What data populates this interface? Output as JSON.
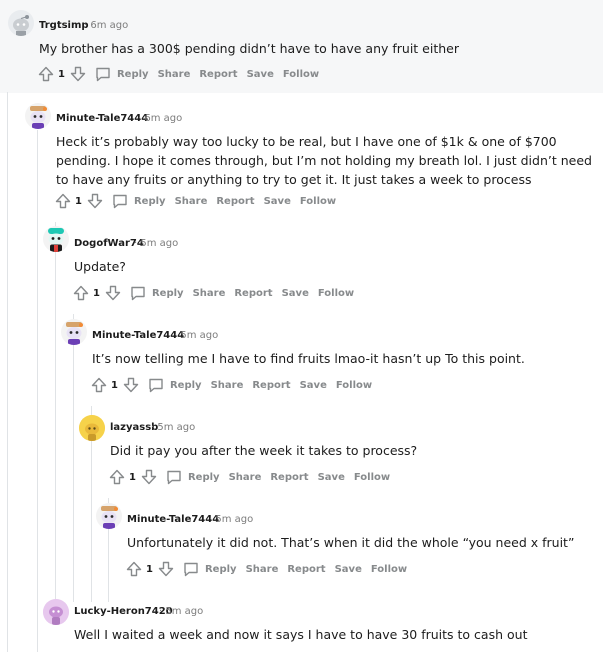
{
  "actions": {
    "reply": "Reply",
    "share": "Share",
    "report": "Report",
    "save": "Save",
    "follow": "Follow"
  },
  "comments": [
    {
      "author": "Trgtsimp",
      "time": "6m ago",
      "body": "My brother has a 300$ pending didn’t have to have any fruit either",
      "votes": "1",
      "avatar": "snoo-avatar-gray"
    },
    {
      "author": "Minute-Tale7444",
      "time": "6m ago",
      "body": "Heck it’s probably way too lucky to be real, but I have one of $1k & one of $700 pending. I hope it comes through, but I’m not holding my breath lol. I just didn’t need to have any fruits or anything to try to get it. It just takes a week to process",
      "votes": "1",
      "avatar": "snoo-avatar-purple-hat"
    },
    {
      "author": "DogofWar74",
      "time": "5m ago",
      "body": "Update?",
      "votes": "1",
      "avatar": "snoo-avatar-teal"
    },
    {
      "author": "Minute-Tale7444",
      "time": "5m ago",
      "body": "It’s now telling me I have to find fruits lmao-it hasn’t up To this point.",
      "votes": "1",
      "avatar": "snoo-avatar-purple-hat"
    },
    {
      "author": "lazyassb",
      "time": "5m ago",
      "body": "Did it pay you after the week it takes to process?",
      "votes": "1",
      "avatar": "snoo-avatar-yellow"
    },
    {
      "author": "Minute-Tale7444",
      "time": "5m ago",
      "body": "Unfortunately it did not. That’s when it did the whole “you need x fruit”",
      "votes": "1",
      "avatar": "snoo-avatar-purple-hat"
    },
    {
      "author": "Lucky-Heron7420",
      "time": "5m ago",
      "body": "Well I waited a week and now it says I have to have 30 fruits to cash out",
      "avatar": "snoo-avatar-pink"
    }
  ],
  "colors": {
    "text": "#1c1c1c",
    "meta": "#7c7c7c",
    "action": "#878a8c",
    "thread_line": "#e0e3e6",
    "highlight_bg": "#f6f7f8"
  }
}
